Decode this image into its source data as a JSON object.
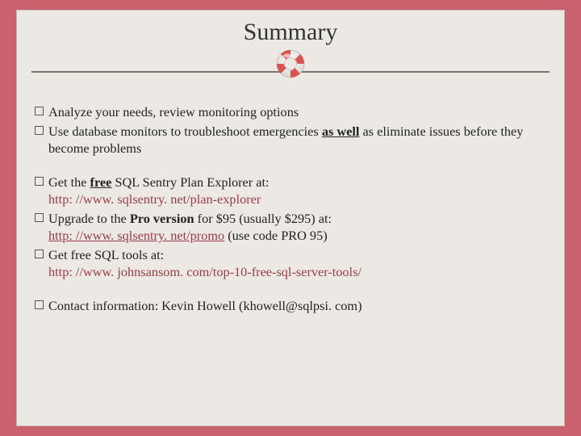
{
  "title": "Summary",
  "groups": [
    {
      "items": [
        {
          "html": "Analyze your needs, review monitoring options"
        },
        {
          "html": "Use database monitors to troubleshoot emergencies <span class='bu'>as well</span> as eliminate issues before they become problems"
        }
      ]
    },
    {
      "items": [
        {
          "html": "Get the <span class='bu'>free</span> SQL Sentry Plan Explorer at: <br><span class='link'>http: //www. sqlsentry. net/plan-explorer</span>"
        },
        {
          "html": "Upgrade to the <span class='bold'>Pro version</span> for $95 (usually $295) at: <br><span class='link uline'>http: //www. sqlsentry. net/promo</span>  (use code PRO 95)"
        },
        {
          "html": "Get free SQL tools at: <br><span class='link'>http: //www. johnsansom. com/top-10-free-sql-server-tools/</span>"
        }
      ]
    },
    {
      "items": [
        {
          "html": "Contact information: Kevin Howell (khowell@sqlpsi. com)"
        }
      ]
    }
  ]
}
